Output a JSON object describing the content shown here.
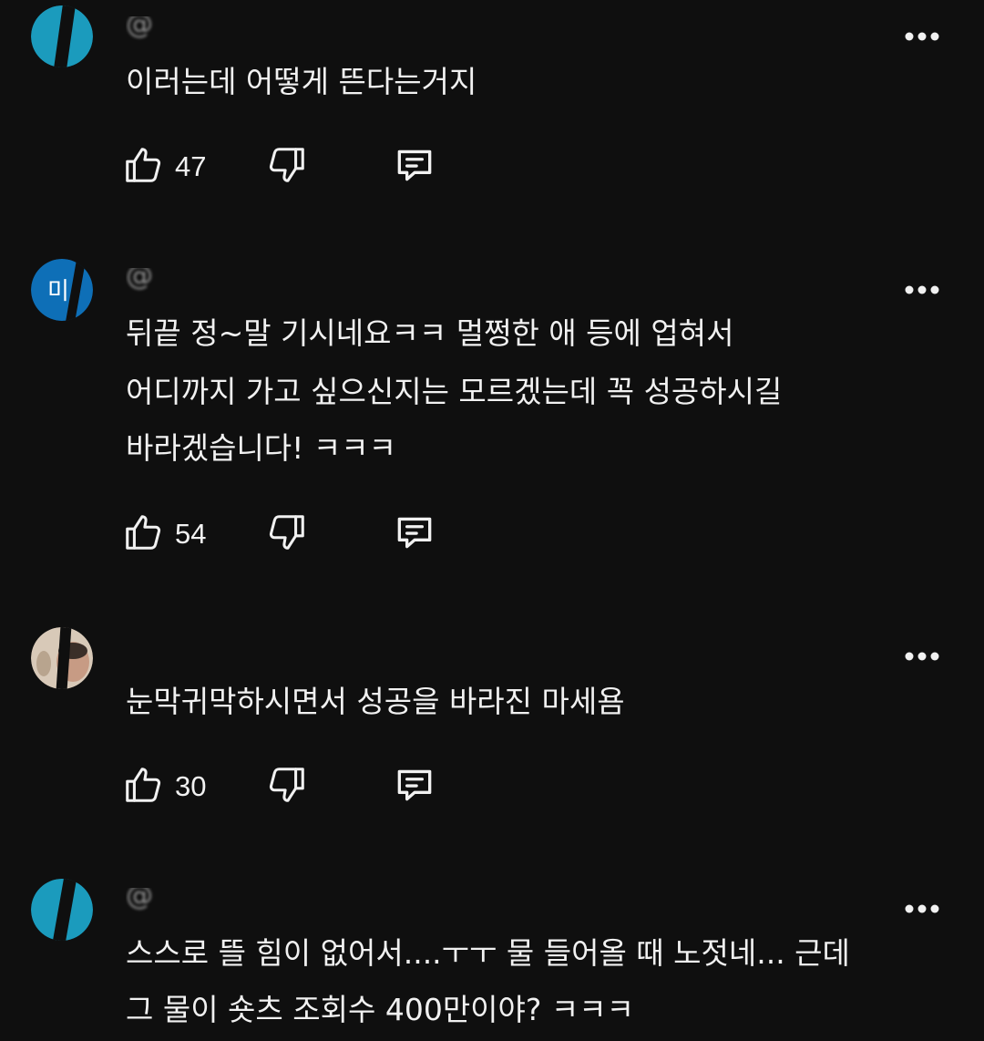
{
  "comments": [
    {
      "avatar_icon": "avatar-teal",
      "avatar_color": "#1b9bbd",
      "handle": "@",
      "lines": [
        "이러는데 어떻게 뜬다는거지"
      ],
      "likes": "47",
      "icons": {
        "like": "thumbs-up-icon",
        "dislike": "thumbs-down-icon",
        "reply": "reply-icon",
        "more": "more-vert-icon"
      }
    },
    {
      "avatar_icon": "avatar-blue-text",
      "avatar_color": "#0e6fb7",
      "avatar_text": "미",
      "handle": "@",
      "lines": [
        "뒤끝 정~말 기시네요ㅋㅋ 멀쩡한 애 등에 업혀서",
        "어디까지 가고 싶으신지는 모르겠는데 꼭 성공하시길",
        "바라겠습니다! ㅋㅋㅋ"
      ],
      "likes": "54",
      "icons": {
        "like": "thumbs-up-icon",
        "dislike": "thumbs-down-icon",
        "reply": "reply-icon",
        "more": "more-vert-icon"
      }
    },
    {
      "avatar_icon": "avatar-photo",
      "avatar_color": "#d8c9b8",
      "handle": "",
      "lines": [
        "눈막귀막하시면서 성공을 바라진 마세욤"
      ],
      "likes": "30",
      "icons": {
        "like": "thumbs-up-icon",
        "dislike": "thumbs-down-icon",
        "reply": "reply-icon",
        "more": "more-vert-icon"
      }
    },
    {
      "avatar_icon": "avatar-teal",
      "avatar_color": "#1b9bbd",
      "handle": "@",
      "lines": [
        "스스로 뜰 힘이 없어서....ㅜㅜ 물 들어올 때 노젓네... 근데",
        "그 물이 숏츠 조회수 400만이야? ㅋㅋㅋ"
      ],
      "likes": "",
      "icons": {
        "more": "more-vert-icon"
      }
    }
  ],
  "colors": {
    "background": "#0f0f0f",
    "text": "#f1f1f1",
    "muted": "#aaaaaa"
  }
}
